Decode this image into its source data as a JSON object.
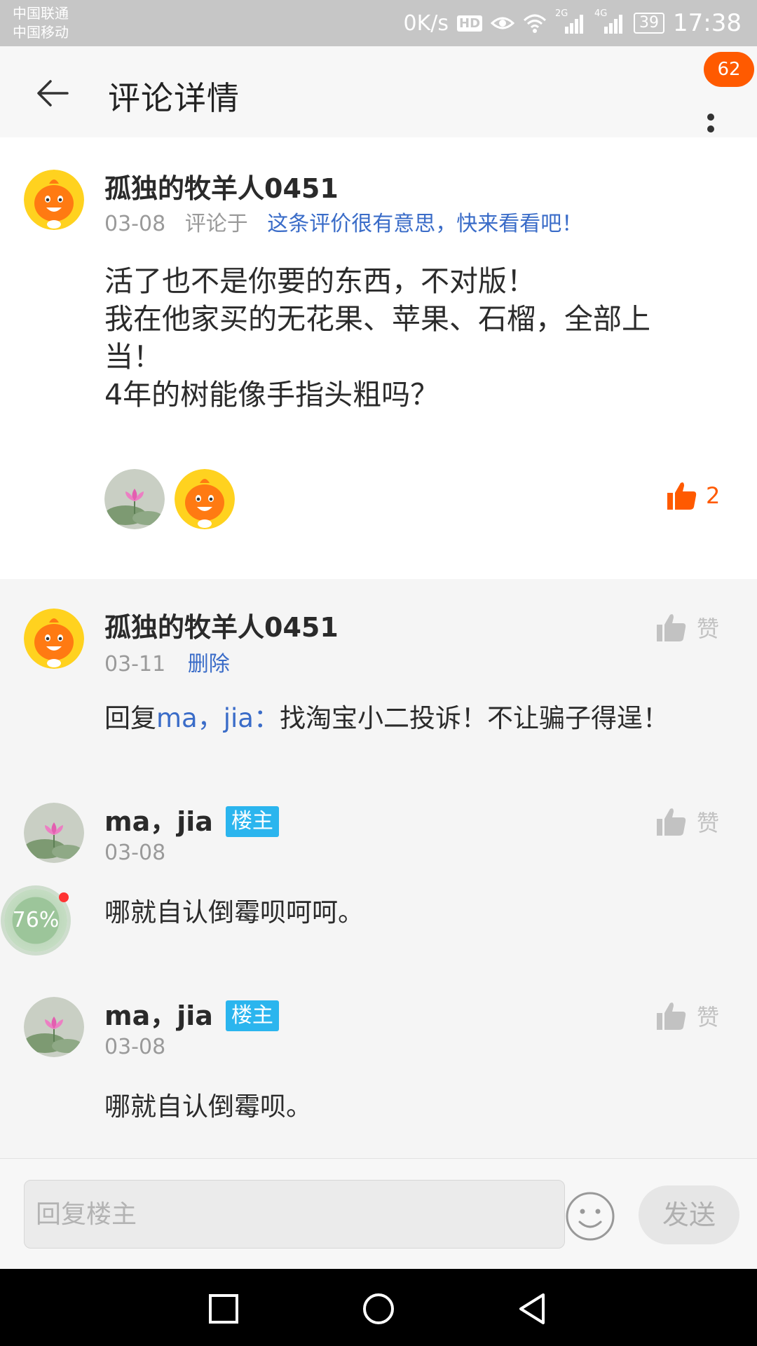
{
  "status_bar": {
    "carrier_1": "中国联通",
    "carrier_2": "中国移动",
    "speed": "0K/s",
    "hd": "HD",
    "net_2g": "2G",
    "net_4g": "4G",
    "battery": "39",
    "time": "17:38",
    "icons": [
      "eye-icon",
      "wifi-icon",
      "signal-icon",
      "signal-icon",
      "battery-icon"
    ]
  },
  "header": {
    "title": "评论详情",
    "badge_count": "62",
    "icons": [
      "back-arrow-icon",
      "more-vertical-icon"
    ]
  },
  "main_comment": {
    "username": "孤独的牧羊人0451",
    "date": "03-08",
    "commented_on_label": "评论于",
    "link_text": "这条评价很有意思，快来看看吧！",
    "body_lines": [
      "活了也不是你要的东西，不对版！",
      "我在他家买的无花果、苹果、石榴，全部上",
      "当！",
      "4年的树能像手指头粗吗？"
    ],
    "like_count": "2",
    "like_color": "#ff5a00"
  },
  "replies": [
    {
      "username": "孤独的牧羊人0451",
      "date": "03-11",
      "action": "删除",
      "text_prefix": "回复",
      "at_user": "ma，jia：",
      "text": "找淘宝小二投诉！不让骗子得逞！",
      "zan_label": "赞"
    },
    {
      "username": "ma，jia",
      "tag": "楼主",
      "date": "03-08",
      "text": "哪就自认倒霉呗呵呵。",
      "zan_label": "赞"
    },
    {
      "username": "ma，jia",
      "tag": "楼主",
      "date": "03-08",
      "text": "哪就自认倒霉呗。",
      "zan_label": "赞"
    }
  ],
  "floating_widget": {
    "percent": "76%"
  },
  "input_bar": {
    "placeholder": "回复楼主",
    "send_label": "发送",
    "icons": [
      "emoji-icon"
    ]
  },
  "colors": {
    "accent": "#ff5a00",
    "link": "#3a6cc8",
    "owner_tag": "#2bb5ee"
  }
}
